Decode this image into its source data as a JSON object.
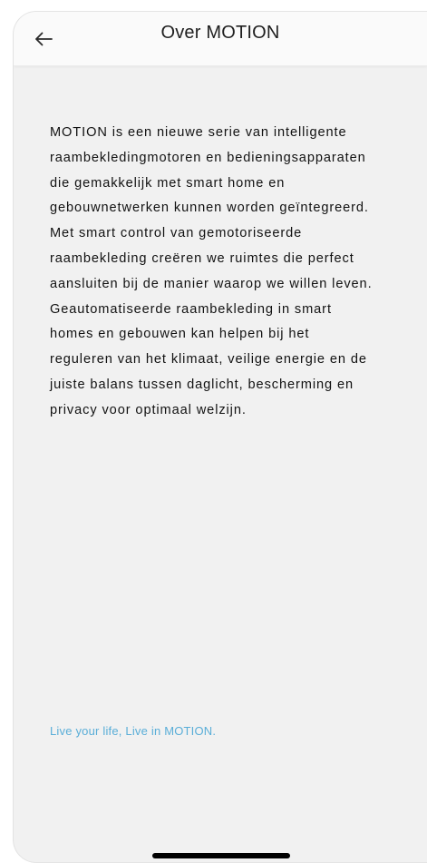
{
  "header": {
    "title": "Over MOTION",
    "back_icon": "arrow-left-icon"
  },
  "content": {
    "lines": [
      "MOTION is een nieuwe serie van intelligente",
      "raambekledingmotoren en bedieningsapparaten",
      "die gemakkelijk met smart home en",
      "gebouwnetwerken kunnen worden geïntegreerd.",
      "Met smart control van gemotoriseerde",
      "raambekleding creëren we ruimtes die perfect",
      "aansluiten bij de manier waarop we willen leven.",
      "Geautomatiseerde raambekleding in smart",
      "homes en gebouwen kan helpen bij het",
      "reguleren van het klimaat, veilige energie en de",
      "juiste balans tussen daglicht, bescherming en",
      "privacy voor optimaal welzijn."
    ],
    "tagline": "Live your life, Live in MOTION."
  },
  "colors": {
    "background": "#f1f1f1",
    "header": "#fafafa",
    "text": "#121212",
    "accent": "#5aaed8"
  }
}
